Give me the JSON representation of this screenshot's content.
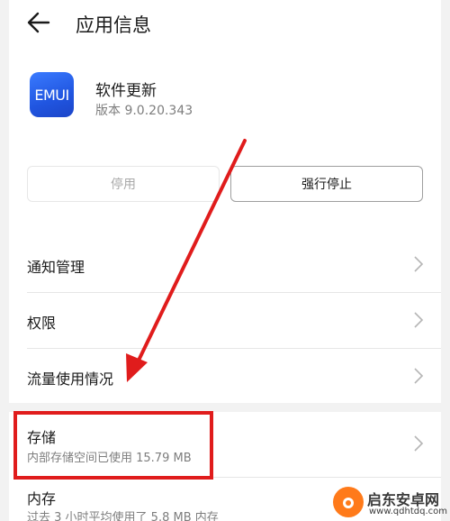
{
  "header": {
    "title": "应用信息",
    "back_icon": "arrow-left-icon"
  },
  "app": {
    "icon_text": "EMUI",
    "name": "软件更新",
    "version": "版本 9.0.20.343",
    "icon_color": "#2b63f0"
  },
  "buttons": {
    "disable_label": "停用",
    "force_stop_label": "强行停止"
  },
  "settings": {
    "notification": "通知管理",
    "permissions": "权限",
    "data_usage": "流量使用情况",
    "storage_title": "存储",
    "storage_sub": "内部存储空间已使用 15.79 MB",
    "memory_title": "内存",
    "memory_sub": "过去 3 小时平均使用了 5.8 MB 内存"
  },
  "annotation": {
    "color": "#e01c1c"
  },
  "watermark": {
    "title": "启东安卓网",
    "url": "www.qdhtdq.com"
  }
}
